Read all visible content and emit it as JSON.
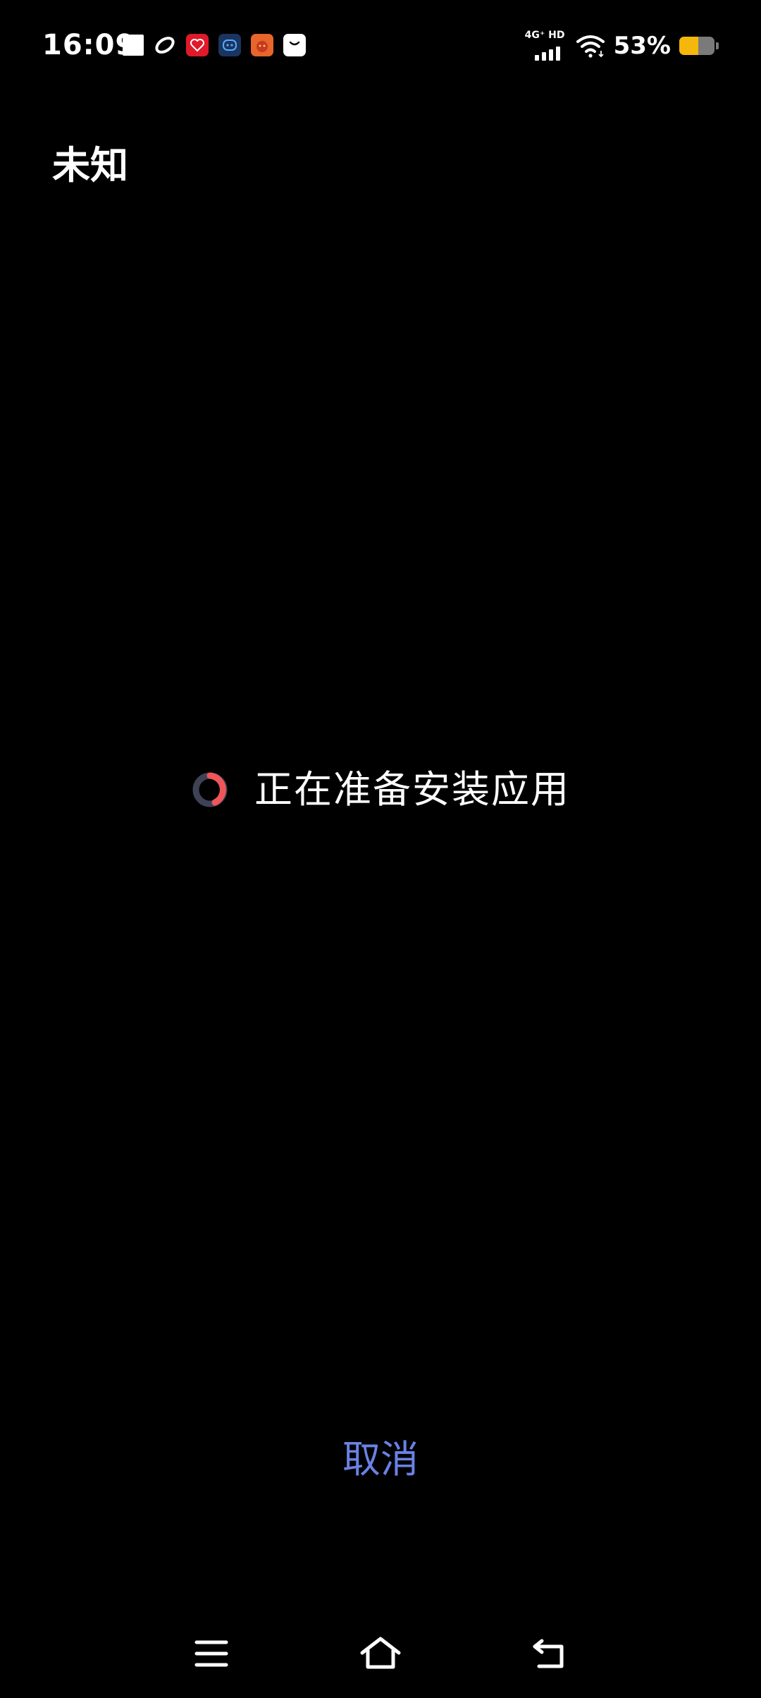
{
  "status_bar": {
    "time": "16:09",
    "network_label": "4G⁺ HD",
    "battery_percent_text": "53%",
    "battery_level": 0.53,
    "notification_icons": [
      "square-icon",
      "ring-app-icon",
      "red-app-icon",
      "blue-robot-app-icon",
      "orange-app-icon",
      "white-bag-app-icon"
    ]
  },
  "header": {
    "title": "未知"
  },
  "progress": {
    "message": "正在准备安装应用",
    "spinner_icon": "loading-spinner-icon"
  },
  "actions": {
    "cancel_label": "取消"
  },
  "navigation": {
    "items": [
      "menu-icon",
      "home-icon",
      "back-icon"
    ]
  },
  "colors": {
    "background": "#000000",
    "text": "#ffffff",
    "accent": "#6a82e6",
    "spinner_track": "#3d4256",
    "spinner_active": "#f0555a",
    "battery_fill": "#f5b70a"
  }
}
